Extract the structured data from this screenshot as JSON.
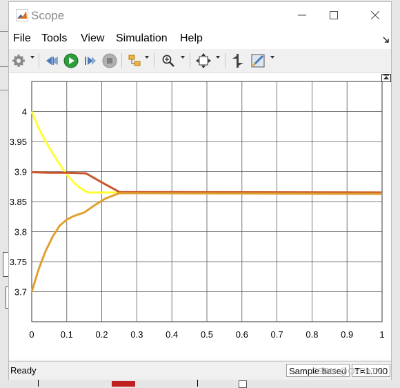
{
  "window": {
    "title": "Scope"
  },
  "menu": [
    "File",
    "Tools",
    "View",
    "Simulation",
    "Help"
  ],
  "toolbar": {
    "icons": [
      "gear-icon",
      "step-back-icon",
      "run-icon",
      "step-forward-icon",
      "stop-icon",
      "highlight-block-icon",
      "zoom-icon",
      "fit-to-view-icon",
      "cursor-measurements-icon",
      "style-icon"
    ]
  },
  "status": {
    "text": "Ready",
    "sample": "Sample based",
    "time": "T=1.000",
    "watermark": "CSDN @OxRhTVi"
  },
  "chart_data": {
    "type": "line",
    "xlim": [
      0,
      1
    ],
    "ylim": [
      3.65,
      4.05
    ],
    "xticks": [
      "0",
      "0.1",
      "0.2",
      "0.3",
      "0.4",
      "0.5",
      "0.6",
      "0.7",
      "0.8",
      "0.9",
      "1"
    ],
    "yticks": [
      "3.7",
      "3.75",
      "3.8",
      "3.85",
      "3.9",
      "3.95",
      "4"
    ],
    "grid": true,
    "series": [
      {
        "color": "#ffff33",
        "points": [
          [
            0,
            4.0
          ],
          [
            0.02,
            3.972
          ],
          [
            0.04,
            3.95
          ],
          [
            0.06,
            3.93
          ],
          [
            0.08,
            3.912
          ],
          [
            0.1,
            3.895
          ],
          [
            0.12,
            3.882
          ],
          [
            0.14,
            3.872
          ],
          [
            0.16,
            3.865
          ],
          [
            0.2,
            3.865
          ],
          [
            0.25,
            3.865
          ],
          [
            1.0,
            3.865
          ]
        ]
      },
      {
        "color": "#c9552a",
        "points": [
          [
            0,
            3.899
          ],
          [
            0.05,
            3.898
          ],
          [
            0.1,
            3.898
          ],
          [
            0.155,
            3.897
          ],
          [
            0.2,
            3.882
          ],
          [
            0.25,
            3.866
          ],
          [
            1.0,
            3.865
          ]
        ]
      },
      {
        "color": "#e0a030",
        "points": [
          [
            0,
            3.7
          ],
          [
            0.02,
            3.738
          ],
          [
            0.04,
            3.768
          ],
          [
            0.06,
            3.792
          ],
          [
            0.08,
            3.81
          ],
          [
            0.1,
            3.82
          ],
          [
            0.12,
            3.826
          ],
          [
            0.15,
            3.832
          ],
          [
            0.18,
            3.844
          ],
          [
            0.21,
            3.855
          ],
          [
            0.25,
            3.864
          ],
          [
            1.0,
            3.863
          ]
        ]
      }
    ]
  }
}
